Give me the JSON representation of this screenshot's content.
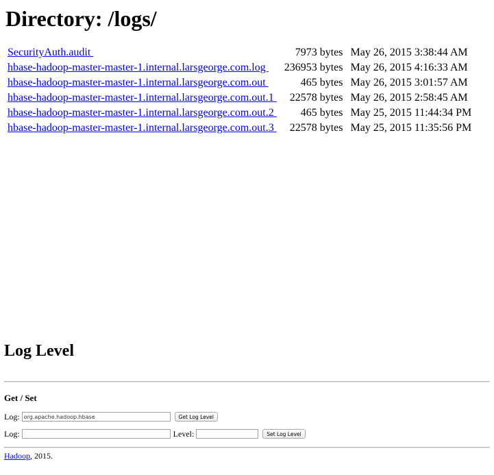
{
  "directory": {
    "title": "Directory: /logs/",
    "files": [
      {
        "name": "SecurityAuth.audit ",
        "size": "7973 bytes",
        "date": "May 26, 2015 3:38:44 AM"
      },
      {
        "name": "hbase-hadoop-master-master-1.internal.larsgeorge.com.log ",
        "size": "236953 bytes",
        "date": "May 26, 2015 4:16:33 AM"
      },
      {
        "name": "hbase-hadoop-master-master-1.internal.larsgeorge.com.out ",
        "size": "465 bytes",
        "date": "May 26, 2015 3:01:57 AM"
      },
      {
        "name": "hbase-hadoop-master-master-1.internal.larsgeorge.com.out.1 ",
        "size": "22578 bytes",
        "date": "May 26, 2015 2:58:45 AM"
      },
      {
        "name": "hbase-hadoop-master-master-1.internal.larsgeorge.com.out.2 ",
        "size": "465 bytes",
        "date": "May 25, 2015 11:44:34 PM"
      },
      {
        "name": "hbase-hadoop-master-master-1.internal.larsgeorge.com.out.3 ",
        "size": "22578 bytes",
        "date": "May 25, 2015 11:35:56 PM"
      }
    ]
  },
  "loglevel": {
    "title": "Log Level",
    "subtitle": "Get / Set",
    "get_row": {
      "log_label": "Log:",
      "log_value": "org.apache.hadoop.hbase",
      "button_label": "Get Log Level"
    },
    "set_row": {
      "log_label": "Log:",
      "log_value": "",
      "level_label": "Level:",
      "level_value": "",
      "button_label": "Set Log Level"
    }
  },
  "footer": {
    "link_text": "Hadoop",
    "suffix": ", 2015."
  },
  "colors": {
    "link": "#0000ee"
  }
}
